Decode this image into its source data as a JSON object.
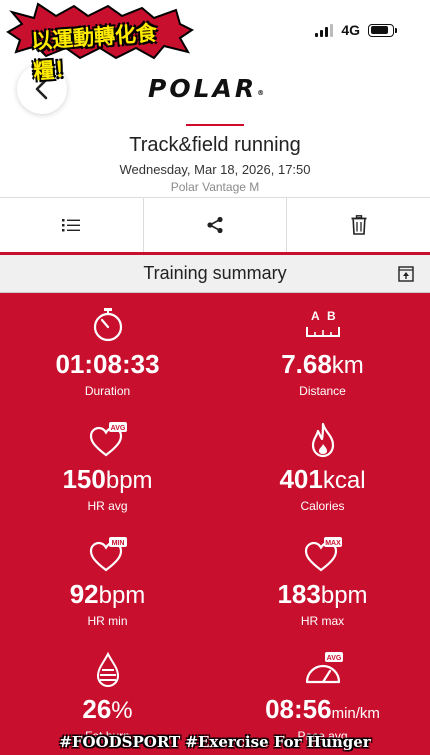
{
  "status_bar": {
    "network": "4G"
  },
  "sticker": {
    "text": "以運動轉化食糧！"
  },
  "header": {
    "brand": "POLAR",
    "sport": "Track&field running",
    "datetime": "Wednesday, Mar 18, 2026, 17:50",
    "device": "Polar Vantage M"
  },
  "actions": [
    {
      "icon": "list-icon"
    },
    {
      "icon": "share-icon"
    },
    {
      "icon": "trash-icon"
    }
  ],
  "summary": {
    "title": "Training summary",
    "stats": [
      {
        "icon": "stopwatch-icon",
        "value": "01:08:33",
        "unit": "",
        "label": "Duration"
      },
      {
        "icon": "distance-icon",
        "value": "7.68",
        "unit": "km",
        "label": "Distance",
        "icon_text": [
          "A",
          "B"
        ]
      },
      {
        "icon": "heart-avg-icon",
        "value": "150",
        "unit": "bpm",
        "label": "HR avg",
        "icon_text": "AVG"
      },
      {
        "icon": "flame-icon",
        "value": "401",
        "unit": "kcal",
        "label": "Calories"
      },
      {
        "icon": "heart-min-icon",
        "value": "92",
        "unit": "bpm",
        "label": "HR min",
        "icon_text": "MIN"
      },
      {
        "icon": "heart-max-icon",
        "value": "183",
        "unit": "bpm",
        "label": "HR max",
        "icon_text": "MAX"
      },
      {
        "icon": "fat-burn-icon",
        "value": "26",
        "unit": "%",
        "label": "Fat burn"
      },
      {
        "icon": "pace-avg-icon",
        "value": "08:56",
        "unit": "min/km",
        "label": "Pace avg",
        "icon_text": "AVG"
      }
    ]
  },
  "overlay": {
    "hashtag": "#FOODSPORT #Exercise For Hunger"
  },
  "colors": {
    "accent": "#c8102e",
    "sticker_yellow": "#ffeb00"
  }
}
